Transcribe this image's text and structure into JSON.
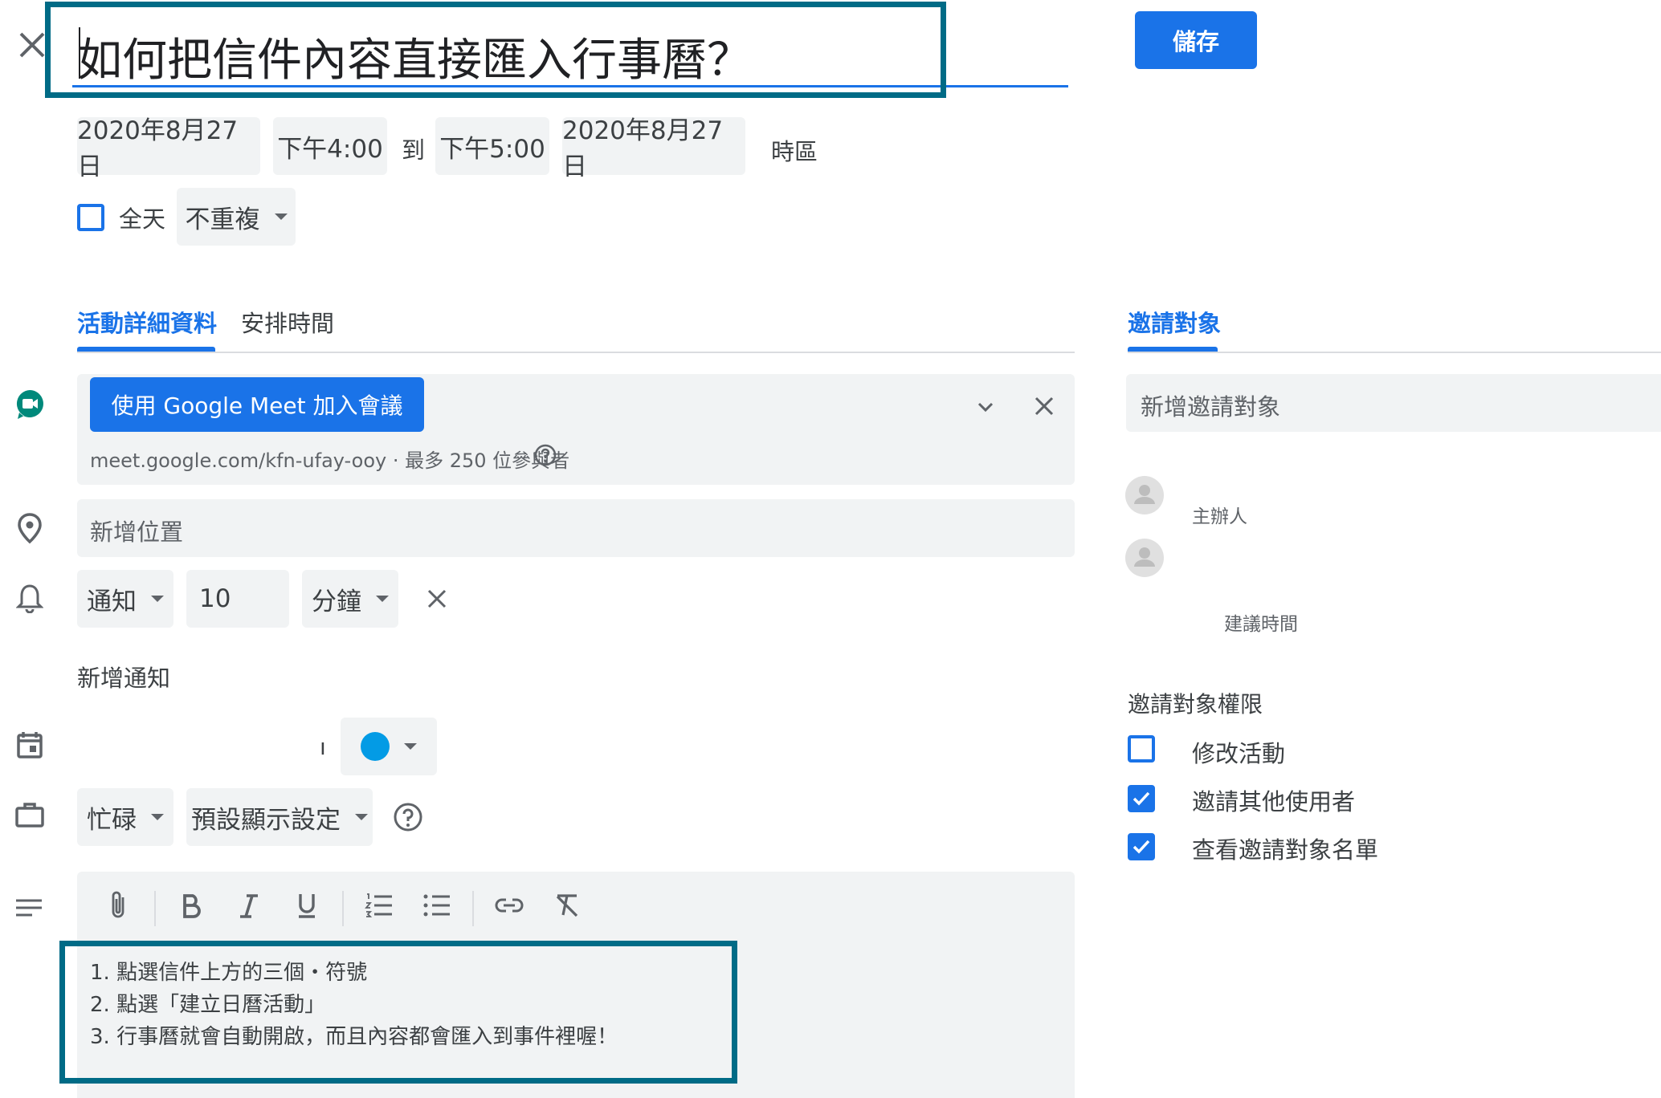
{
  "header": {
    "title": "如何把信件內容直接匯入行事曆？",
    "save_label": "儲存"
  },
  "datetime": {
    "start_date": "2020年8月27日",
    "start_time": "下午4:00",
    "to_label": "到",
    "end_time": "下午5:00",
    "end_date": "2020年8月27日",
    "timezone_label": "時區"
  },
  "options": {
    "all_day_label": "全天",
    "repeat_label": "不重複"
  },
  "tabs": [
    {
      "label": "活動詳細資料",
      "active": true
    },
    {
      "label": "安排時間",
      "active": false
    }
  ],
  "meet": {
    "join_label": "使用 Google Meet 加入會議",
    "link_text": "meet.google.com/kfn-ufay-ooy · 最多 250 位參與者"
  },
  "location": {
    "placeholder": "新增位置"
  },
  "notification": {
    "type": "通知",
    "value": "10",
    "unit": "分鐘",
    "add_label": "新增通知"
  },
  "calendar": {
    "name": "ı",
    "color": "#039be5"
  },
  "availability": {
    "busy_label": "忙碌",
    "visibility_label": "預設顯示設定"
  },
  "description": {
    "lines": [
      "1. 點選信件上方的三個・符號",
      "2. 點選「建立日曆活動」",
      "3. 行事曆就會自動開啟，而且內容都會匯入到事件裡喔！"
    ]
  },
  "guests": {
    "tab_label": "邀請對象",
    "add_placeholder": "新增邀請對象",
    "organizer_label": "主辦人",
    "suggest_label": "建議時間",
    "permissions_title": "邀請對象權限",
    "permissions": [
      {
        "label": "修改活動",
        "checked": false
      },
      {
        "label": "邀請其他使用者",
        "checked": true
      },
      {
        "label": "查看邀請對象名單",
        "checked": true
      }
    ]
  },
  "colors": {
    "accent": "#1a73e8",
    "highlight_frame": "#006b86",
    "field_bg": "#f1f3f4"
  }
}
